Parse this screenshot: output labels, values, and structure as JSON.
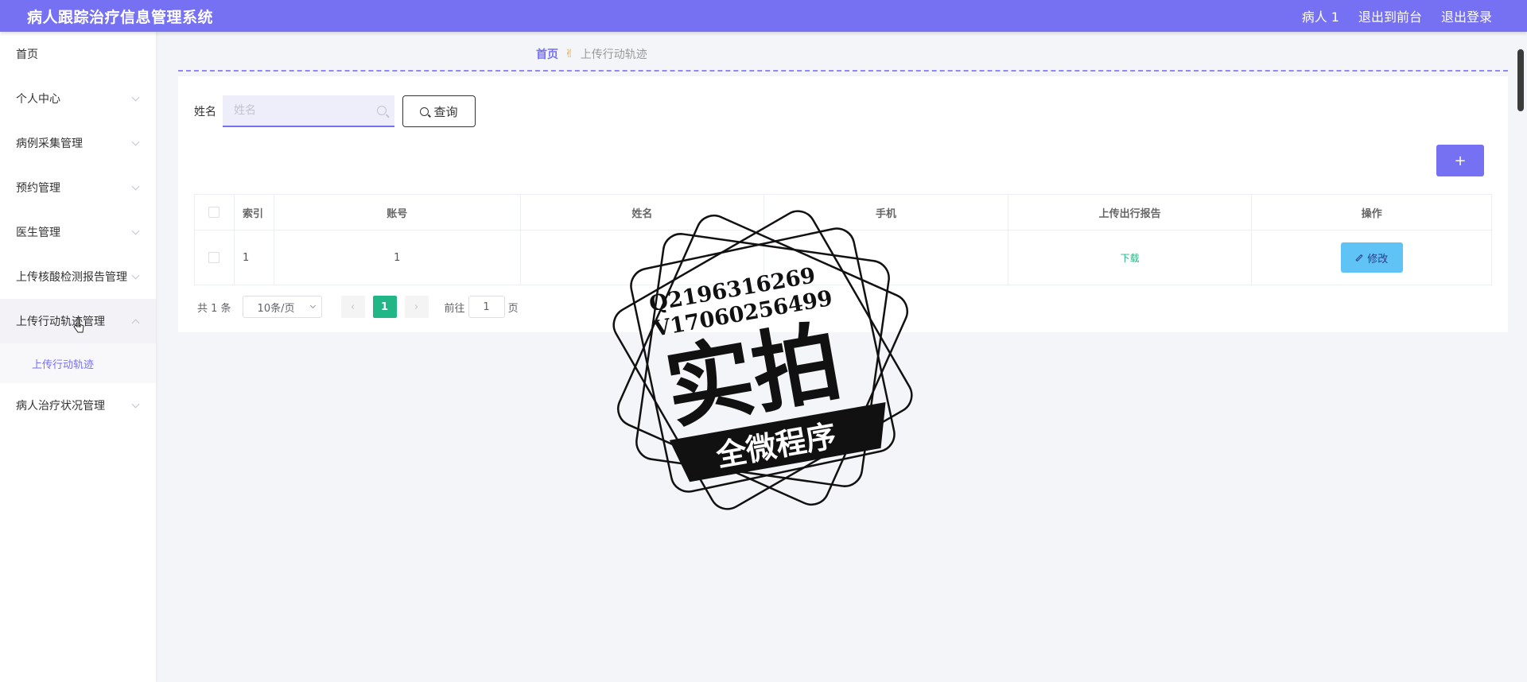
{
  "header": {
    "title": "病人跟踪治疗信息管理系统",
    "user": "病人 1",
    "back_to_front": "退出到前台",
    "logout": "退出登录",
    "accent_color": "#7670f2"
  },
  "sidebar": {
    "items": [
      {
        "label": "首页"
      },
      {
        "label": "个人中心"
      },
      {
        "label": "病例采集管理"
      },
      {
        "label": "预约管理"
      },
      {
        "label": "医生管理"
      },
      {
        "label": "上传核酸检测报告管理"
      },
      {
        "label": "上传行动轨迹管理"
      },
      {
        "label": "病人治疗状况管理"
      }
    ],
    "submenu": [
      {
        "label": "上传行动轨迹"
      }
    ]
  },
  "breadcrumb": {
    "home": "首页",
    "current": "上传行动轨迹",
    "separator_icon": "hand-icon"
  },
  "search": {
    "label": "姓名",
    "placeholder": "姓名",
    "button": "查询"
  },
  "actions": {
    "add_label": "+"
  },
  "table": {
    "columns": [
      "索引",
      "账号",
      "姓名",
      "手机",
      "上传出行报告",
      "操作"
    ],
    "rows": [
      {
        "index": "1",
        "account": "1",
        "name": "",
        "phone": "",
        "report": "下载",
        "action": "修改"
      }
    ]
  },
  "pagination": {
    "total": "共 1 条",
    "page_size": "10条/页",
    "current_page": "1",
    "goto_label": "前往",
    "goto_value": "1",
    "page_suffix": "页"
  },
  "watermark": {
    "line1": "Q2196316269",
    "line2": "V17060256499",
    "big": "实拍",
    "banner": "全微程序"
  }
}
